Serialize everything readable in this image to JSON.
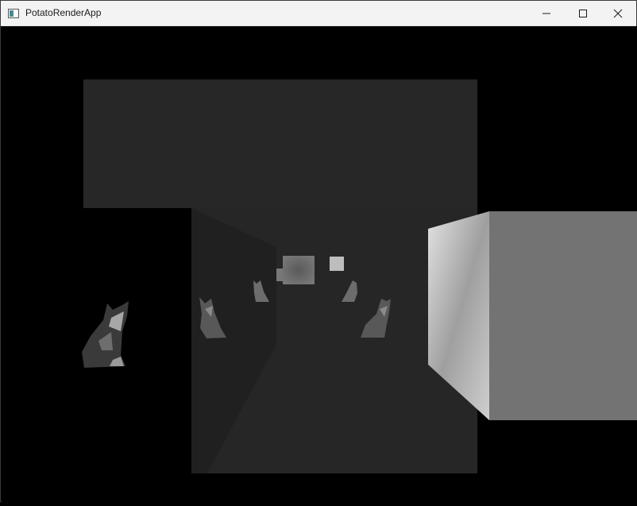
{
  "window": {
    "title": "PotatoRenderApp",
    "controls": {
      "minimize_icon": "minimize-icon",
      "maximize_icon": "maximize-icon",
      "close_icon": "close-icon"
    }
  },
  "scene": {
    "background": "#000000",
    "colors": {
      "wall": "#272727",
      "left_wall": "#202020",
      "cube_left_face": "#c9c9c9",
      "cube_right_face": "#737373",
      "cat_dark": "#3a3a3a",
      "cat_light": "#8a8a8a"
    }
  }
}
